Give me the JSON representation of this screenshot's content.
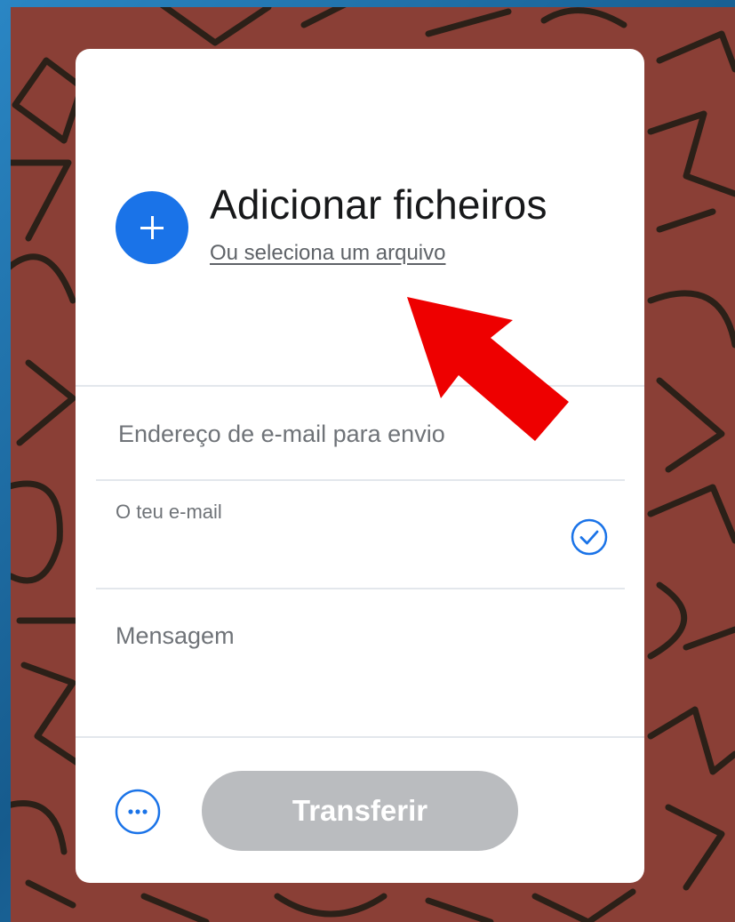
{
  "colors": {
    "accent": "#1a73e8",
    "card_background": "#ffffff",
    "backdrop": "#8a3f36",
    "button_disabled": "#babcbf",
    "annotation_arrow": "#ee0000"
  },
  "upload": {
    "title": "Adicionar ficheiros",
    "link": "Ou seleciona um arquivo",
    "button_icon": "plus-icon"
  },
  "form": {
    "recipient_placeholder": "Endereço de e-mail para envio",
    "sender_label": "O teu e-mail",
    "sender_value": "",
    "sender_status_icon": "check-circle-icon",
    "message_placeholder": "Mensagem"
  },
  "actions": {
    "more_icon": "more-options-icon",
    "transfer_label": "Transferir"
  },
  "overlay": {
    "annotation_icon": "red-arrow-icon"
  }
}
